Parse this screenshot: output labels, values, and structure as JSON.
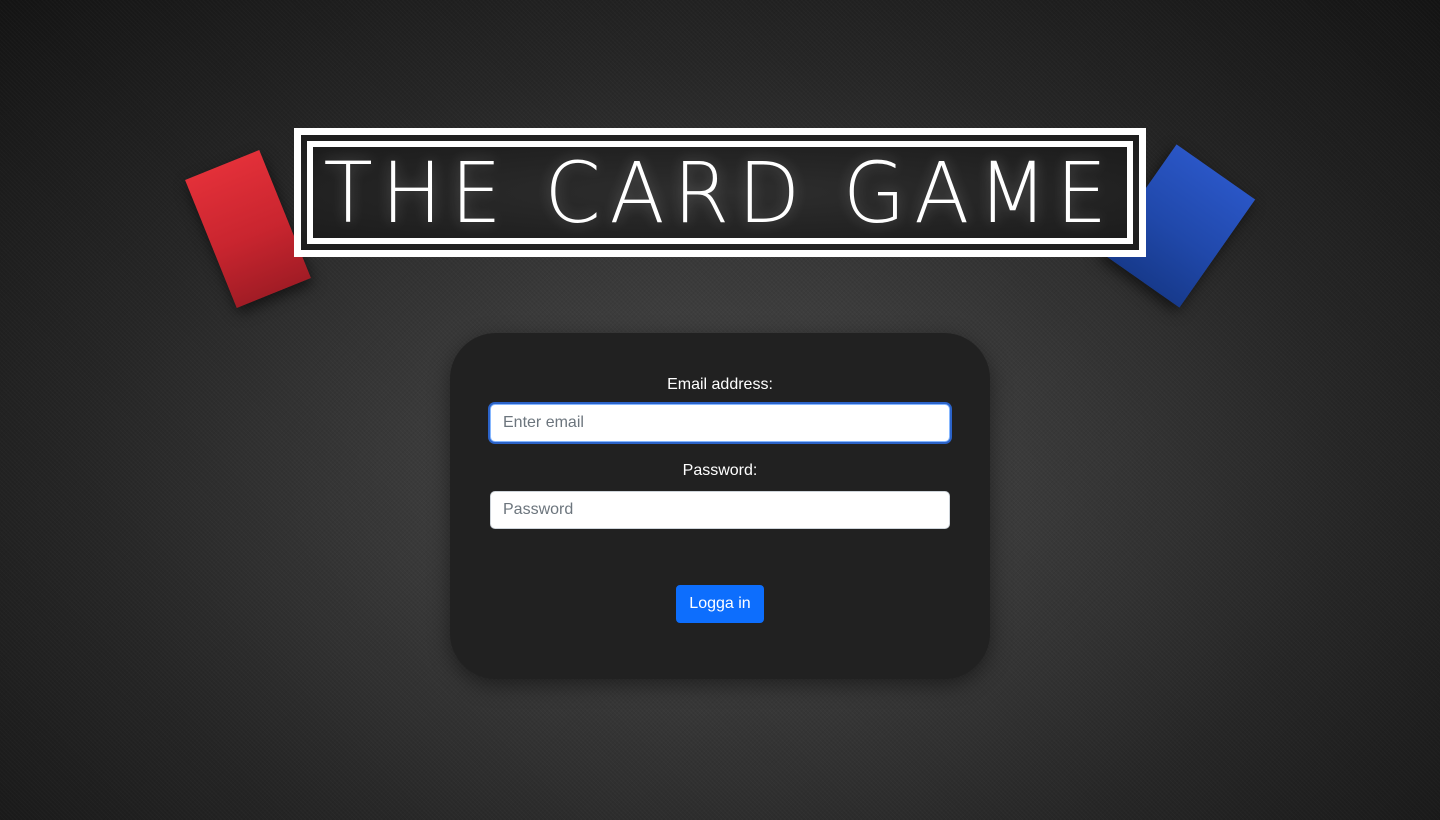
{
  "app": {
    "logo_text": "THE CARD GAME"
  },
  "login": {
    "email_label": "Email address:",
    "email_placeholder": "Enter email",
    "email_value": "",
    "password_label": "Password:",
    "password_placeholder": "Password",
    "password_value": "",
    "submit_label": "Logga in"
  },
  "colors": {
    "card_red": "#c9252f",
    "card_blue": "#2048aa",
    "panel_background": "#212121",
    "button_primary": "#0d6efd"
  }
}
